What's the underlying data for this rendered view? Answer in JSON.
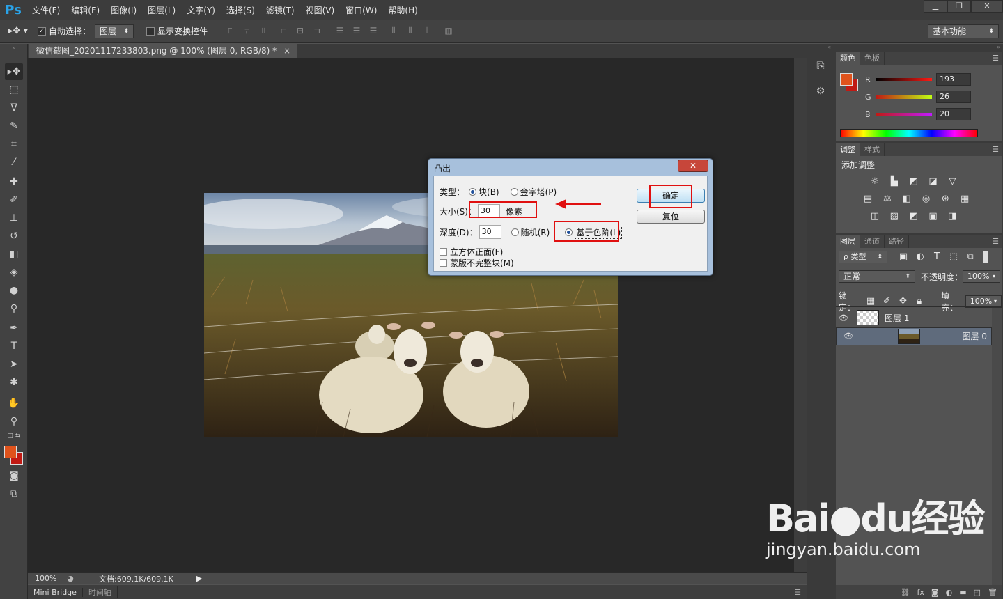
{
  "app": {
    "logo": "Ps"
  },
  "menu": [
    "文件(F)",
    "编辑(E)",
    "图像(I)",
    "图层(L)",
    "文字(Y)",
    "选择(S)",
    "滤镜(T)",
    "视图(V)",
    "窗口(W)",
    "帮助(H)"
  ],
  "window_controls": {
    "minimize": "▁",
    "maximize": "❐",
    "close": "✕"
  },
  "options": {
    "auto_select_label": "自动选择：",
    "auto_select_checked": true,
    "auto_select_target": "图层",
    "show_transform_label": "显示变换控件",
    "show_transform_checked": false,
    "workspace": "基本功能"
  },
  "document": {
    "tab_title": "微信截图_20201117233803.png @ 100% (图层 0, RGB/8) *",
    "tab_close": "×"
  },
  "status": {
    "zoom": "100%",
    "doc_info": "文档:609.1K/609.1K"
  },
  "bottom_tabs": [
    "Mini Bridge",
    "时间轴"
  ],
  "dialog": {
    "title": "凸出",
    "close": "✕",
    "type_label": "类型：",
    "type_options": [
      {
        "label": "块(B)",
        "checked": true
      },
      {
        "label": "金字塔(P)",
        "checked": false
      }
    ],
    "size_label": "大小(S)：",
    "size_value": "30",
    "size_unit": "像素",
    "depth_label": "深度(D)：",
    "depth_value": "30",
    "depth_options": [
      {
        "label": "随机(R)",
        "checked": false
      },
      {
        "label": "基于色阶(L)",
        "checked": true
      }
    ],
    "solid_front": "立方体正面(F)",
    "mask_incomplete": "蒙版不完整块(M)",
    "ok": "确定",
    "reset": "复位"
  },
  "color_panel": {
    "tabs": [
      "颜色",
      "色板"
    ],
    "channels": [
      {
        "name": "R",
        "value": "193"
      },
      {
        "name": "G",
        "value": "26"
      },
      {
        "name": "B",
        "value": "20"
      }
    ],
    "foreground": "#c11a14",
    "fg_tool": "#e0531c"
  },
  "adjust_panel": {
    "tabs": [
      "调整",
      "样式"
    ],
    "heading": "添加调整"
  },
  "layers_panel": {
    "tabs": [
      "图层",
      "通道",
      "路径"
    ],
    "filter_label": "ρ 类型",
    "blend_mode": "正常",
    "opacity_label": "不透明度：",
    "opacity": "100%",
    "lock_label": "锁定：",
    "fill_label": "填充：",
    "fill": "100%",
    "layers": [
      {
        "name": "图层 1",
        "selected": false
      },
      {
        "name": "图层 0",
        "selected": true
      }
    ]
  },
  "watermark": {
    "logo": "Bai●du经验",
    "url": "jingyan.baidu.com"
  }
}
